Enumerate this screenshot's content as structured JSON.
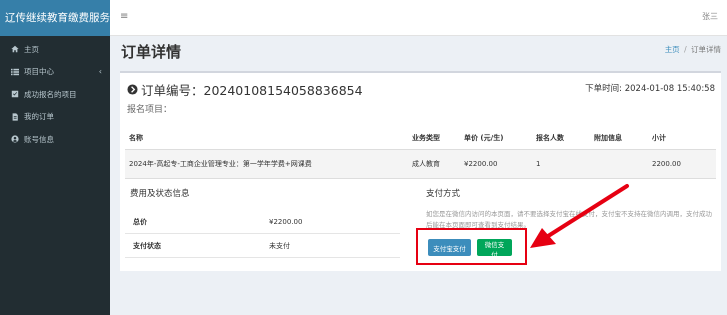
{
  "sidebar": {
    "brand": "辽传继续教育缴费服务平台",
    "items": [
      {
        "label": "主页",
        "icon": "home-icon"
      },
      {
        "label": "项目中心",
        "icon": "list-icon",
        "has_submenu": true
      },
      {
        "label": "成功报名的项目",
        "icon": "check-square-icon"
      },
      {
        "label": "我的订单",
        "icon": "file-icon"
      },
      {
        "label": "账号信息",
        "icon": "user-circle-icon"
      }
    ],
    "chevron": "‹"
  },
  "topbar": {
    "toggle": "≡",
    "user": "张三"
  },
  "header": {
    "title": "订单详情",
    "breadcrumb": {
      "home": "主页",
      "separator": "/",
      "current": "订单详情"
    }
  },
  "order": {
    "number_text": "订单编号：20240108154058836854",
    "time_text": "下单时间: 2024-01-08 15:40:58",
    "project_label": "报名项目："
  },
  "items_table": {
    "columns": [
      "名称",
      "业务类型",
      "单价 (元/生)",
      "报名人数",
      "附加信息",
      "小计"
    ],
    "rows": [
      [
        "2024年-高起专-工商企业管理专业：第一学年学费+网课费",
        "成人教育",
        "¥2200.00",
        "1",
        "",
        "2200.00"
      ]
    ]
  },
  "fees": {
    "title": "费用及状态信息",
    "rows": [
      {
        "label": "总价",
        "value": "¥2200.00"
      },
      {
        "label": "支付状态",
        "value": "未支付"
      }
    ]
  },
  "payment": {
    "title": "支付方式",
    "note": "如您是在微信内访问的本页面，请不要选择支付宝在线支付，支付宝不支持在微信内调用，支付成功后能在本页面即可查看到支付结果。",
    "alipay_label": "支付宝支付",
    "wechat_label": "微信支付"
  },
  "colors": {
    "sidebar_bg": "#222d32",
    "brand_bg": "#367fa9",
    "alipay": "#3c8dbc",
    "wechat": "#00a65a",
    "annotation": "#e60012"
  }
}
